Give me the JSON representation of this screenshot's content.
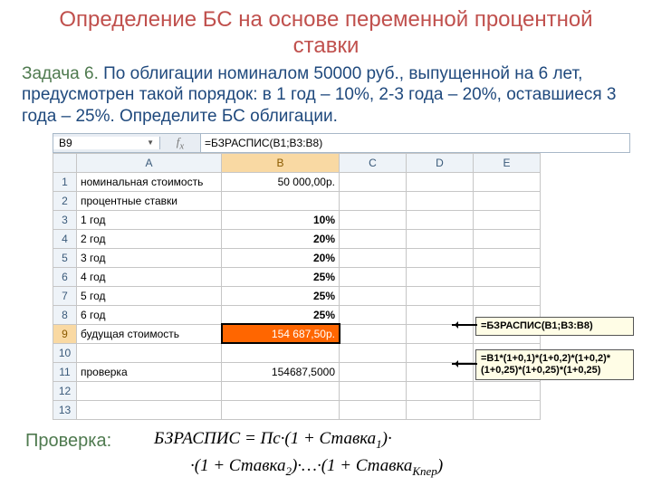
{
  "title": "Определение БС на основе переменной процентной ставки",
  "problem": {
    "label": "Задача 6.",
    "text": " По облигации номиналом 50000 руб., выпущенной на 6 лет, предусмотрен такой порядок: в 1 год – 10%, 2-3 года – 20%, оставшиеся 3 года – 25%. Определите БС облигации."
  },
  "namebox": "B9",
  "formula_bar": "=БЗРАСПИС(B1;B3:B8)",
  "columns": [
    "A",
    "B",
    "C",
    "D",
    "E"
  ],
  "rows": [
    {
      "n": "1",
      "a": "номинальная стоимость",
      "b": "50 000,00р."
    },
    {
      "n": "2",
      "a": "процентные ставки",
      "b": ""
    },
    {
      "n": "3",
      "a": "1 год",
      "b": "10%"
    },
    {
      "n": "4",
      "a": "2 год",
      "b": "20%"
    },
    {
      "n": "5",
      "a": "3 год",
      "b": "20%"
    },
    {
      "n": "6",
      "a": "4 год",
      "b": "25%"
    },
    {
      "n": "7",
      "a": "5 год",
      "b": "25%"
    },
    {
      "n": "8",
      "a": "6 год",
      "b": "25%"
    },
    {
      "n": "9",
      "a": "будущая стоимость",
      "b": "154 687,50р."
    },
    {
      "n": "10",
      "a": "",
      "b": ""
    },
    {
      "n": "11",
      "a": "проверка",
      "b": "154687,5000"
    },
    {
      "n": "12",
      "a": "",
      "b": ""
    },
    {
      "n": "13",
      "a": "",
      "b": ""
    }
  ],
  "callouts": {
    "c1": "=БЗРАСПИС(B1;B3:B8)",
    "c2": "=B1*(1+0,1)*(1+0,2)*(1+0,2)*(1+0,25)*(1+0,25)*(1+0,25)"
  },
  "check_label": "Проверка:",
  "math": {
    "line1a": "БЗРАСПИС",
    "line1b": " = Пс·(1 + Ставка",
    "line1c": ")·",
    "line2a": "·(1 + Ставка",
    "line2b": ")·…·(1 + Ставка",
    "line2c": ")",
    "sub1": "1",
    "sub2": "2",
    "sub3": "Кпер"
  },
  "chart_data": {
    "type": "table",
    "title": "Определение БС на основе переменной процентной ставки",
    "columns": [
      "A",
      "B"
    ],
    "rows": [
      [
        "номинальная стоимость",
        "50 000,00р."
      ],
      [
        "процентные ставки",
        ""
      ],
      [
        "1 год",
        "10%"
      ],
      [
        "2 год",
        "20%"
      ],
      [
        "3 год",
        "20%"
      ],
      [
        "4 год",
        "25%"
      ],
      [
        "5 год",
        "25%"
      ],
      [
        "6 год",
        "25%"
      ],
      [
        "будущая стоимость",
        "154 687,50р."
      ],
      [
        "",
        ""
      ],
      [
        "проверка",
        "154687,5000"
      ]
    ],
    "formulas": {
      "B9": "=БЗРАСПИС(B1;B3:B8)",
      "B11": "=B1*(1+0,1)*(1+0,2)*(1+0,2)*(1+0,25)*(1+0,25)*(1+0,25)"
    }
  }
}
